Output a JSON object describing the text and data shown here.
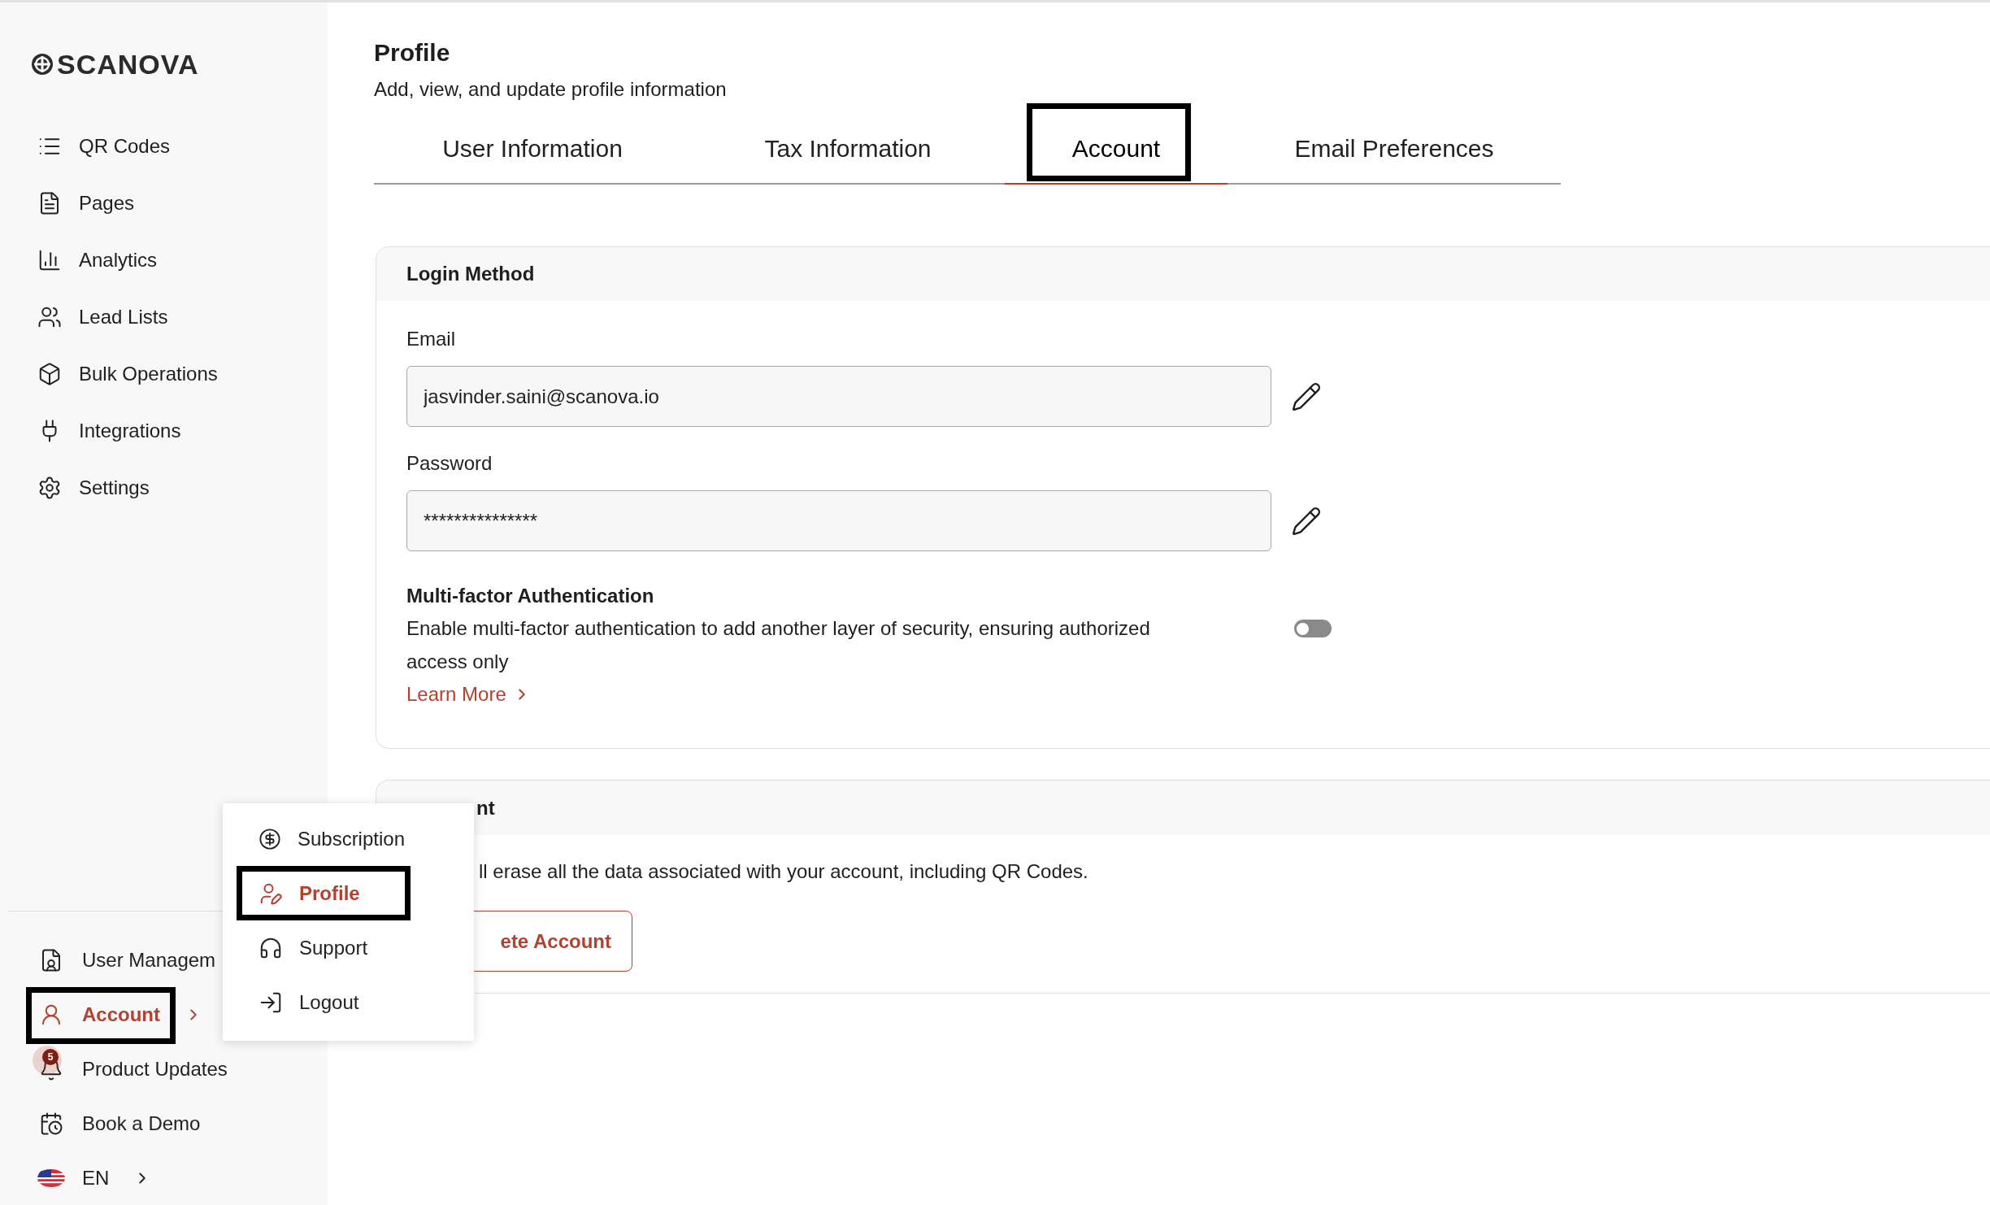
{
  "sidebar": {
    "logo": "SCANOVA",
    "items": [
      {
        "kind": "list",
        "label": "QR Codes"
      },
      {
        "kind": "page",
        "label": "Pages"
      },
      {
        "kind": "chart",
        "label": "Analytics"
      },
      {
        "kind": "users",
        "label": "Lead Lists"
      },
      {
        "kind": "box",
        "label": "Bulk Operations"
      },
      {
        "kind": "plug",
        "label": "Integrations"
      },
      {
        "kind": "gear",
        "label": "Settings"
      }
    ],
    "bottom_items": [
      {
        "kind": "user-doc",
        "label": "User Managem",
        "selected": false,
        "highlighted": false,
        "submenu": false
      },
      {
        "kind": "user",
        "label": "Account",
        "selected": true,
        "highlighted": true,
        "submenu": true
      },
      {
        "kind": "bell",
        "label": "Product Updates",
        "selected": false,
        "highlighted": false,
        "submenu": false,
        "badge": "5"
      },
      {
        "kind": "calendar",
        "label": "Book a Demo",
        "selected": false,
        "highlighted": false,
        "submenu": false
      },
      {
        "kind": "flag",
        "label": "EN",
        "selected": false,
        "highlighted": false,
        "submenu": true
      }
    ]
  },
  "account_menu": [
    {
      "kind": "dollar",
      "label": "Subscription",
      "selected": false,
      "highlighted": false
    },
    {
      "kind": "user-pen",
      "label": "Profile",
      "selected": true,
      "highlighted": true
    },
    {
      "kind": "headphones",
      "label": "Support",
      "selected": false,
      "highlighted": false
    },
    {
      "kind": "logout",
      "label": "Logout",
      "selected": false,
      "highlighted": false
    }
  ],
  "page": {
    "title": "Profile",
    "subtitle": "Add, view, and update profile information"
  },
  "tabs": [
    {
      "label": "User Information",
      "selected": false,
      "highlighted": false
    },
    {
      "label": "Tax Information",
      "selected": false,
      "highlighted": false
    },
    {
      "label": "Account",
      "selected": true,
      "highlighted": true
    },
    {
      "label": "Email Preferences",
      "selected": false,
      "highlighted": false
    }
  ],
  "login_card": {
    "title": "Login Method",
    "fields": [
      {
        "label": "Email",
        "value": "jasvinder.saini@scanova.io"
      },
      {
        "label": "Password",
        "value": "***************"
      }
    ],
    "mfa": {
      "title": "Multi-factor Authentication",
      "description": "Enable multi-factor authentication to add another layer of security, ensuring authorized access only",
      "link": "Learn More",
      "on": false
    }
  },
  "delete_card": {
    "title": "nt",
    "description": "ll erase all the data associated with your account, including QR Codes.",
    "button": "ete Account"
  }
}
